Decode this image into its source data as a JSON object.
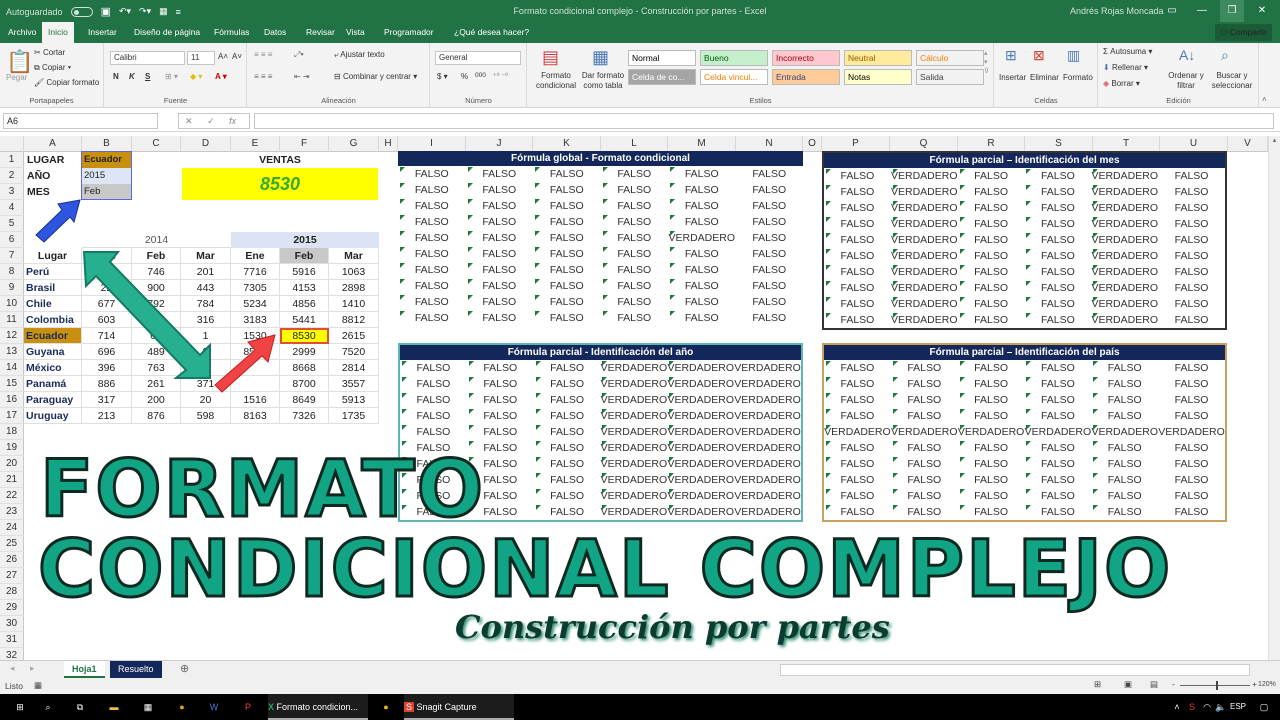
{
  "window": {
    "autosave_label": "Autoguardado",
    "title": "Formato condicional complejo - Construcción por partes - Excel",
    "user": "Andrés Rojas Moncada"
  },
  "ribbon_tabs": [
    "Archivo",
    "Inicio",
    "Insertar",
    "Diseño de página",
    "Fórmulas",
    "Datos",
    "Revisar",
    "Vista",
    "Programador",
    "¿Qué desea hacer?"
  ],
  "active_tab": "Inicio",
  "share_label": "Compartir",
  "ribbon": {
    "clipboard": {
      "paste": "Pegar",
      "cut": "Cortar",
      "copy": "Copiar",
      "format_painter": "Copiar formato",
      "label": "Portapapeles"
    },
    "font": {
      "name": "Calibri",
      "size": "11",
      "bold": "N",
      "italic": "K",
      "underline": "S",
      "label": "Fuente"
    },
    "alignment": {
      "wrap": "Ajustar texto",
      "merge": "Combinar y centrar",
      "label": "Alineación"
    },
    "number": {
      "format": "General",
      "currency": "$",
      "percent": "%",
      "thousands": "000",
      "label": "Número"
    },
    "styles": {
      "cond_format": "Formato condicional",
      "table_format": "Dar formato como tabla",
      "label": "Estilos",
      "cells": [
        {
          "label": "Normal",
          "bg": "#ffffff",
          "fg": "#000000"
        },
        {
          "label": "Bueno",
          "bg": "#c6efce",
          "fg": "#006100"
        },
        {
          "label": "Incorrecto",
          "bg": "#ffc7ce",
          "fg": "#9c0006"
        },
        {
          "label": "Neutral",
          "bg": "#ffeb9c",
          "fg": "#9c5700"
        },
        {
          "label": "Cálculo",
          "bg": "#f2f2f2",
          "fg": "#fa7d00"
        },
        {
          "label": "Celda de co...",
          "bg": "#a5a5a5",
          "fg": "#ffffff"
        },
        {
          "label": "Celda vincul...",
          "bg": "#ffffff",
          "fg": "#fa7d00"
        },
        {
          "label": "Entrada",
          "bg": "#ffcc99",
          "fg": "#3f3f76"
        },
        {
          "label": "Notas",
          "bg": "#ffffcc",
          "fg": "#000000"
        },
        {
          "label": "Salida",
          "bg": "#f2f2f2",
          "fg": "#3f3f3f"
        }
      ]
    },
    "cells": {
      "insert": "Insertar",
      "delete": "Eliminar",
      "format": "Formato",
      "label": "Celdas"
    },
    "editing": {
      "autosum": "Autosuma",
      "fill": "Rellenar",
      "clear": "Borrar",
      "sort": "Ordenar y filtrar",
      "find": "Buscar y seleccionar",
      "label": "Edición"
    }
  },
  "formula_bar": {
    "name_box": "A6",
    "fx": "fx",
    "value": ""
  },
  "columns": [
    "A",
    "B",
    "C",
    "D",
    "E",
    "F",
    "G",
    "H",
    "I",
    "J",
    "K",
    "L",
    "M",
    "N",
    "O",
    "P",
    "Q",
    "R",
    "S",
    "T",
    "U",
    "V"
  ],
  "rows": [
    "1",
    "2",
    "3",
    "4",
    "5",
    "6",
    "7",
    "8",
    "9",
    "10",
    "11",
    "12",
    "13",
    "14",
    "15",
    "16",
    "17",
    "18",
    "19",
    "20",
    "21",
    "22",
    "23",
    "24",
    "25",
    "26",
    "27",
    "28",
    "29",
    "30",
    "31",
    "32"
  ],
  "params": {
    "labels": [
      "LUGAR",
      "AÑO",
      "MES"
    ],
    "values": [
      "Ecuador",
      "2015",
      "Feb"
    ]
  },
  "ventas": {
    "label": "VENTAS",
    "value": "8530"
  },
  "sales_table": {
    "year_headers": [
      "2014",
      "2015"
    ],
    "headers": [
      "Lugar",
      "Ene",
      "Feb",
      "Mar",
      "Ene",
      "Feb",
      "Mar"
    ],
    "rows": [
      [
        "Perú",
        "",
        "746",
        "201",
        "7716",
        "5916",
        "1063"
      ],
      [
        "Brasil",
        "22",
        "900",
        "443",
        "7305",
        "4153",
        "2898"
      ],
      [
        "Chile",
        "677",
        "792",
        "784",
        "5234",
        "4856",
        "1410"
      ],
      [
        "Colombia",
        "603",
        "",
        "316",
        "3183",
        "5441",
        "8812"
      ],
      [
        "Ecuador",
        "714",
        "63",
        "1",
        "1530",
        "8530",
        "2615"
      ],
      [
        "Guyana",
        "696",
        "489",
        "9",
        "8541",
        "2999",
        "7520"
      ],
      [
        "México",
        "396",
        "763",
        "9",
        "",
        "8668",
        "2814"
      ],
      [
        "Panamá",
        "886",
        "261",
        "371",
        "",
        "8700",
        "3557"
      ],
      [
        "Paraguay",
        "317",
        "200",
        "20",
        "1516",
        "8649",
        "5913"
      ],
      [
        "Uruguay",
        "213",
        "876",
        "598",
        "8163",
        "7326",
        "1735"
      ]
    ],
    "highlight_color": "#ffff00",
    "country_highlight_color": "#c8900e"
  },
  "panels": [
    {
      "title": "Fórmula global - Formato condicional",
      "border": "#13275a",
      "rows": [
        [
          "FALSO",
          "FALSO",
          "FALSO",
          "FALSO",
          "FALSO",
          "FALSO"
        ],
        [
          "FALSO",
          "FALSO",
          "FALSO",
          "FALSO",
          "FALSO",
          "FALSO"
        ],
        [
          "FALSO",
          "FALSO",
          "FALSO",
          "FALSO",
          "FALSO",
          "FALSO"
        ],
        [
          "FALSO",
          "FALSO",
          "FALSO",
          "FALSO",
          "FALSO",
          "FALSO"
        ],
        [
          "FALSO",
          "FALSO",
          "FALSO",
          "FALSO",
          "VERDADERO",
          "FALSO"
        ],
        [
          "FALSO",
          "FALSO",
          "FALSO",
          "FALSO",
          "FALSO",
          "FALSO"
        ],
        [
          "FALSO",
          "FALSO",
          "FALSO",
          "FALSO",
          "FALSO",
          "FALSO"
        ],
        [
          "FALSO",
          "FALSO",
          "FALSO",
          "FALSO",
          "FALSO",
          "FALSO"
        ],
        [
          "FALSO",
          "FALSO",
          "FALSO",
          "FALSO",
          "FALSO",
          "FALSO"
        ],
        [
          "FALSO",
          "FALSO",
          "FALSO",
          "FALSO",
          "FALSO",
          "FALSO"
        ]
      ]
    },
    {
      "title": "Fórmula parcial – Identificación del mes",
      "border": "#333333",
      "rows": [
        [
          "FALSO",
          "VERDADERO",
          "FALSO",
          "FALSO",
          "VERDADERO",
          "FALSO"
        ],
        [
          "FALSO",
          "VERDADERO",
          "FALSO",
          "FALSO",
          "VERDADERO",
          "FALSO"
        ],
        [
          "FALSO",
          "VERDADERO",
          "FALSO",
          "FALSO",
          "VERDADERO",
          "FALSO"
        ],
        [
          "FALSO",
          "VERDADERO",
          "FALSO",
          "FALSO",
          "VERDADERO",
          "FALSO"
        ],
        [
          "FALSO",
          "VERDADERO",
          "FALSO",
          "FALSO",
          "VERDADERO",
          "FALSO"
        ],
        [
          "FALSO",
          "VERDADERO",
          "FALSO",
          "FALSO",
          "VERDADERO",
          "FALSO"
        ],
        [
          "FALSO",
          "VERDADERO",
          "FALSO",
          "FALSO",
          "VERDADERO",
          "FALSO"
        ],
        [
          "FALSO",
          "VERDADERO",
          "FALSO",
          "FALSO",
          "VERDADERO",
          "FALSO"
        ],
        [
          "FALSO",
          "VERDADERO",
          "FALSO",
          "FALSO",
          "VERDADERO",
          "FALSO"
        ],
        [
          "FALSO",
          "VERDADERO",
          "FALSO",
          "FALSO",
          "VERDADERO",
          "FALSO"
        ]
      ]
    },
    {
      "title": "Fórmula parcial - Identificación del año",
      "border": "#5fb4b4",
      "rows": [
        [
          "FALSO",
          "FALSO",
          "FALSO",
          "VERDADERO",
          "VERDADERO",
          "VERDADERO"
        ],
        [
          "FALSO",
          "FALSO",
          "FALSO",
          "VERDADERO",
          "VERDADERO",
          "VERDADERO"
        ],
        [
          "FALSO",
          "FALSO",
          "FALSO",
          "VERDADERO",
          "VERDADERO",
          "VERDADERO"
        ],
        [
          "FALSO",
          "FALSO",
          "FALSO",
          "VERDADERO",
          "VERDADERO",
          "VERDADERO"
        ],
        [
          "FALSO",
          "FALSO",
          "FALSO",
          "VERDADERO",
          "VERDADERO",
          "VERDADERO"
        ],
        [
          "FALSO",
          "FALSO",
          "FALSO",
          "VERDADERO",
          "VERDADERO",
          "VERDADERO"
        ],
        [
          "FALSO",
          "FALSO",
          "FALSO",
          "VERDADERO",
          "VERDADERO",
          "VERDADERO"
        ],
        [
          "FALSO",
          "FALSO",
          "FALSO",
          "VERDADERO",
          "VERDADERO",
          "VERDADERO"
        ],
        [
          "FALSO",
          "FALSO",
          "FALSO",
          "VERDADERO",
          "VERDADERO",
          "VERDADERO"
        ],
        [
          "FALSO",
          "FALSO",
          "FALSO",
          "VERDADERO",
          "VERDADERO",
          "VERDADERO"
        ]
      ]
    },
    {
      "title": "Fórmula parcial – Identificación del país",
      "border": "#c8a060",
      "rows": [
        [
          "FALSO",
          "FALSO",
          "FALSO",
          "FALSO",
          "FALSO",
          "FALSO"
        ],
        [
          "FALSO",
          "FALSO",
          "FALSO",
          "FALSO",
          "FALSO",
          "FALSO"
        ],
        [
          "FALSO",
          "FALSO",
          "FALSO",
          "FALSO",
          "FALSO",
          "FALSO"
        ],
        [
          "FALSO",
          "FALSO",
          "FALSO",
          "FALSO",
          "FALSO",
          "FALSO"
        ],
        [
          "VERDADERO",
          "VERDADERO",
          "VERDADERO",
          "VERDADERO",
          "VERDADERO",
          "VERDADERO"
        ],
        [
          "FALSO",
          "FALSO",
          "FALSO",
          "FALSO",
          "FALSO",
          "FALSO"
        ],
        [
          "FALSO",
          "FALSO",
          "FALSO",
          "FALSO",
          "FALSO",
          "FALSO"
        ],
        [
          "FALSO",
          "FALSO",
          "FALSO",
          "FALSO",
          "FALSO",
          "FALSO"
        ],
        [
          "FALSO",
          "FALSO",
          "FALSO",
          "FALSO",
          "FALSO",
          "FALSO"
        ],
        [
          "FALSO",
          "FALSO",
          "FALSO",
          "FALSO",
          "FALSO",
          "FALSO"
        ]
      ]
    }
  ],
  "overlay": {
    "line1": "FORMATO",
    "line2": "CONDICIONAL COMPLEJO",
    "subtitle": "Construcción por partes"
  },
  "sheets": [
    {
      "label": "Hoja1",
      "active": true
    },
    {
      "label": "Resuelto",
      "active": false
    }
  ],
  "status": {
    "ready": "Listo",
    "zoom": "120%",
    "zoom_level_percent": 120
  },
  "taskbar": {
    "excel_item": "Formato condicion...",
    "snagit_item": "Snagit Capture",
    "lang": "ESP"
  }
}
